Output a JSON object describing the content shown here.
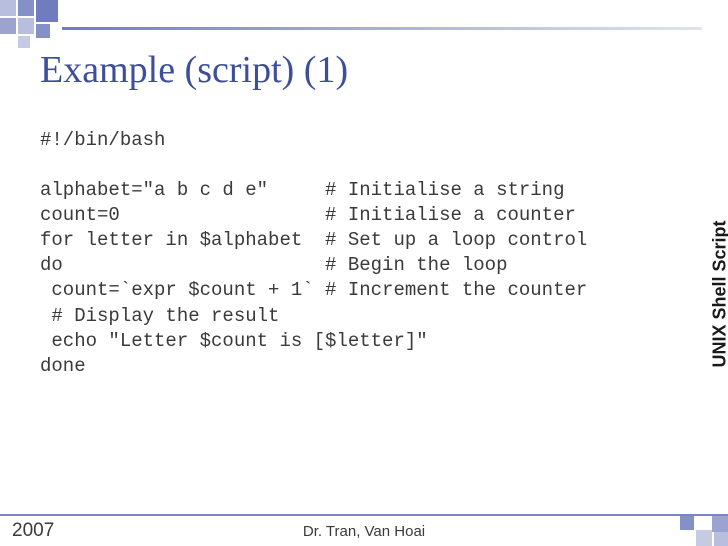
{
  "title": "Example (script) (1)",
  "code": "#!/bin/bash\n\nalphabet=\"a b c d e\"     # Initialise a string\ncount=0                  # Initialise a counter\nfor letter in $alphabet  # Set up a loop control\ndo                       # Begin the loop\n count=`expr $count + 1` # Increment the counter\n # Display the result\n echo \"Letter $count is [$letter]\"\ndone",
  "side_label": "UNIX Shell Script",
  "footer": {
    "year": "2007",
    "author": "Dr. Tran, Van Hoai"
  }
}
